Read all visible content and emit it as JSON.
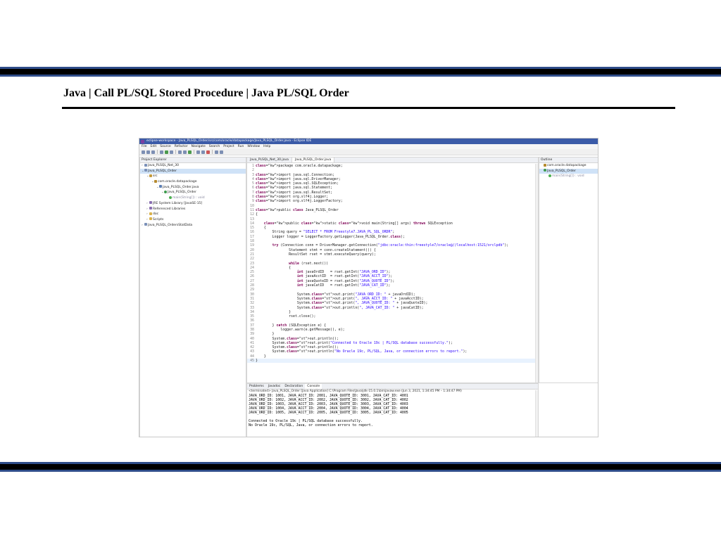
{
  "slide": {
    "title": "Java | Call PL/SQL Stored Procedure | Java PL/SQL Order"
  },
  "ide": {
    "window_title": "eclipse-workspace - Java_PLSQL_Order/src/com/oracle/datapackage/Java_PLSQL_Order.java - Eclipse IDE",
    "menu": [
      "File",
      "Edit",
      "Source",
      "Refactor",
      "Navigate",
      "Search",
      "Project",
      "Run",
      "Window",
      "Help"
    ],
    "explorer": {
      "header": "Project Explorer",
      "items": [
        {
          "label": "Java_PLSQL_Net_30",
          "indent": 0,
          "twisty": "›",
          "icon": "proj",
          "selected": false
        },
        {
          "label": "Java_PLSQL_Order",
          "indent": 0,
          "twisty": "⌄",
          "icon": "proj",
          "selected": true
        },
        {
          "label": "src",
          "indent": 1,
          "twisty": "⌄",
          "icon": "src",
          "selected": false
        },
        {
          "label": "com.oracle.datapackage",
          "indent": 2,
          "twisty": "⌄",
          "icon": "pkg",
          "selected": false
        },
        {
          "label": "Java_PLSQL_Order.java",
          "indent": 3,
          "twisty": "⌄",
          "icon": "file",
          "selected": false
        },
        {
          "label": "Java_PLSQL_Order",
          "indent": 4,
          "twisty": "⌄",
          "icon": "cls",
          "selected": false
        },
        {
          "label": "main(String[]) : void",
          "indent": 5,
          "twisty": "",
          "icon": "meth",
          "selected": false
        },
        {
          "label": "JRE System Library [JavaSE-15]",
          "indent": 1,
          "twisty": "›",
          "icon": "lib",
          "selected": false
        },
        {
          "label": "Referenced Libraries",
          "indent": 1,
          "twisty": "›",
          "icon": "lib",
          "selected": false
        },
        {
          "label": "doc",
          "indent": 1,
          "twisty": "›",
          "icon": "folder",
          "selected": false
        },
        {
          "label": "Scripts",
          "indent": 1,
          "twisty": "›",
          "icon": "folder",
          "selected": false
        },
        {
          "label": "Java_PLSQL_OrdersStatData",
          "indent": 0,
          "twisty": "›",
          "icon": "proj",
          "selected": false
        }
      ]
    },
    "editor": {
      "tabs": [
        "Java_PLSQL_Net_30.java",
        "Java_PLSQL_Order.java"
      ],
      "lines": [
        "package com.oracle.datapackage;",
        "",
        "import java.sql.Connection;",
        "import java.sql.DriverManager;",
        "import java.sql.SQLException;",
        "import java.sql.Statement;",
        "import java.sql.ResultSet;",
        "import org.slf4j.Logger;",
        "import org.slf4j.LoggerFactory;",
        "",
        "public class Java_PLSQL_Order",
        "{",
        "",
        "    public static void main(String[] args) throws SQLException",
        "    {",
        "        String query = \"SELECT * FROM Freestyle7.JAVA_PL_SQL_ORDR\";",
        "        Logger logger = LoggerFactory.getLogger(Java_PLSQL_Order.class);",
        "",
        "        try (Connection conn = DriverManager.getConnection(\"jdbc:oracle:thin:freestyle7/oracle@//localhost:1521/orclpdb\");",
        "                Statement stmt = conn.createStatement()) {",
        "                ResultSet rset = stmt.executeQuery(query);",
        "",
        "                while (rset.next())",
        "                {",
        "                    int javaOrdID   = rset.getInt(\"JAVA_ORD_ID\");",
        "                    int javaAcctID  = rset.getInt(\"JAVA_ACCT_ID\");",
        "                    int javaQuoteID = rset.getInt(\"JAVA_QUOTE_ID\");",
        "                    int javaCatID   = rset.getInt(\"JAVA_CAT_ID\");",
        "",
        "                    System.out.print(\"JAVA_ORD_ID: \" + javaOrdID);",
        "                    System.out.print(\", JAVA_ACCT_ID: \" + javaAcctID);",
        "                    System.out.print(\", JAVA_QUOTE_ID: \" + javaQuoteID);",
        "                    System.out.println(\", JAVA_CAT_ID: \" + javaCatID);",
        "                }",
        "                rset.close();",
        "",
        "        } catch (SQLException e) {",
        "            logger.warn(e.getMessage(), e);",
        "        }",
        "        System.out.println();",
        "        System.out.print(\"Connected to Oracle 19c | PL/SQL database successfully.\");",
        "        System.out.println();",
        "        System.out.println(\"No Oracle 19c, PL/SQL, Java, or connection errors to report.\");",
        "    }",
        "}"
      ],
      "highlight_line": 45
    },
    "outline": {
      "header": "Outline",
      "items": [
        {
          "label": "com.oracle.datapackage",
          "indent": 0,
          "icon": "pkg",
          "selected": false
        },
        {
          "label": "Java_PLSQL_Order",
          "indent": 0,
          "icon": "cls",
          "selected": true
        },
        {
          "label": "main(String[]) : void",
          "indent": 1,
          "icon": "meth",
          "selected": false
        }
      ]
    },
    "console": {
      "tabs": [
        "Problems",
        "Javadoc",
        "Declaration",
        "Console"
      ],
      "status": "<terminated> Java_PLSQL_Order [Java Application] C:\\Program Files\\Java\\jdk-15.0.1\\bin\\javaw.exe (Jun 3, 2021, 1:34:45 PM – 1:34:47 PM)",
      "lines": [
        "JAVA_ORD_ID: 1001, JAVA_ACCT_ID: 2001, JAVA_QUOTE_ID: 3001, JAVA_CAT_ID: 4001",
        "JAVA_ORD_ID: 1002, JAVA_ACCT_ID: 2002, JAVA_QUOTE_ID: 3002, JAVA_CAT_ID: 4002",
        "JAVA_ORD_ID: 1003, JAVA_ACCT_ID: 2003, JAVA_QUOTE_ID: 3003, JAVA_CAT_ID: 4003",
        "JAVA_ORD_ID: 1004, JAVA_ACCT_ID: 2004, JAVA_QUOTE_ID: 3004, JAVA_CAT_ID: 4004",
        "JAVA_ORD_ID: 1005, JAVA_ACCT_ID: 2005, JAVA_QUOTE_ID: 3005, JAVA_CAT_ID: 4005",
        "",
        "Connected to Oracle 19c | PL/SQL database successfully.",
        "No Oracle 19c, PL/SQL, Java, or connection errors to report."
      ]
    },
    "colors": {
      "band": "#000000",
      "band_border": "#2f4d8a",
      "titlebar": "#3b5ba8",
      "keyword": "#7f0055",
      "string": "#2a00ff",
      "selection": "#cfe2f7"
    }
  }
}
